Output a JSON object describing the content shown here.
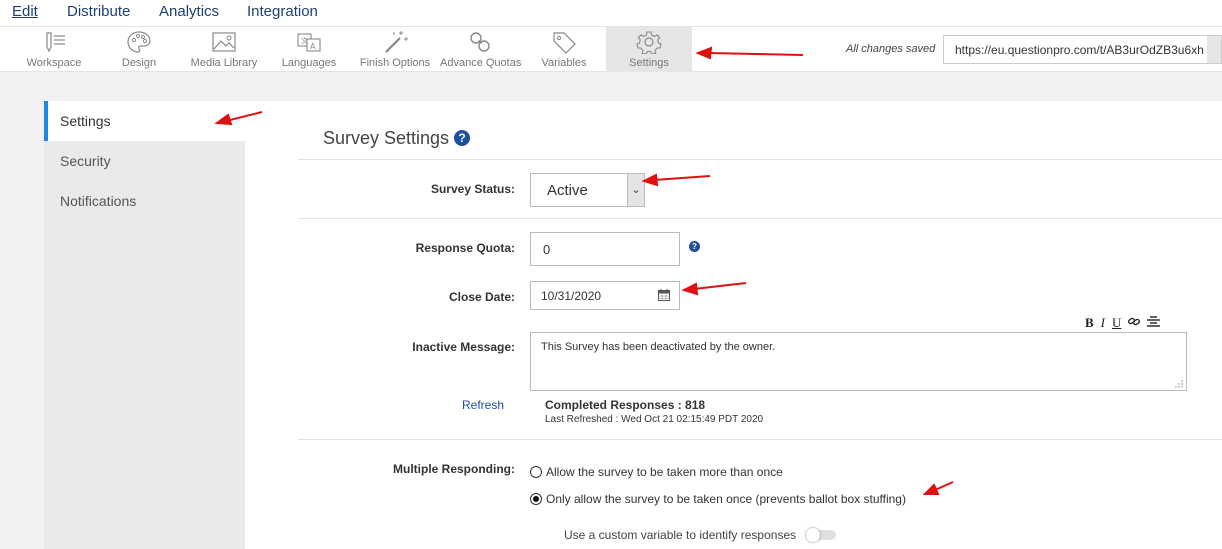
{
  "topnav": {
    "edit": "Edit",
    "distribute": "Distribute",
    "analytics": "Analytics",
    "integration": "Integration"
  },
  "toolbar": {
    "items": [
      {
        "label": "Workspace",
        "icon": "workspace-icon"
      },
      {
        "label": "Design",
        "icon": "palette-icon"
      },
      {
        "label": "Media Library",
        "icon": "image-icon"
      },
      {
        "label": "Languages",
        "icon": "translate-icon"
      },
      {
        "label": "Finish Options",
        "icon": "magic-wand-icon"
      },
      {
        "label": "Advance Quotas",
        "icon": "chain-icon"
      },
      {
        "label": "Variables",
        "icon": "tag-icon"
      },
      {
        "label": "Settings",
        "icon": "gear-icon"
      }
    ],
    "saved_text": "All changes saved",
    "url": "https://eu.questionpro.com/t/AB3urOdZB3u6xh"
  },
  "sidebar": {
    "items": [
      {
        "label": "Settings"
      },
      {
        "label": "Security"
      },
      {
        "label": "Notifications"
      }
    ]
  },
  "main": {
    "title": "Survey Settings",
    "survey_status_label": "Survey Status:",
    "survey_status_value": "Active",
    "response_quota_label": "Response Quota:",
    "response_quota_value": "0",
    "close_date_label": "Close Date:",
    "close_date_value": "10/31/2020",
    "inactive_message_label": "Inactive Message:",
    "inactive_message_value": "This Survey has been deactivated by the owner.",
    "rte": {
      "bold": "B",
      "italic": "I",
      "underline": "U"
    },
    "refresh_label": "Refresh",
    "completed_responses": "Completed Responses : 818",
    "last_refreshed": "Last Refreshed : Wed Oct 21 02:15:49 PDT 2020",
    "multiple_responding_label": "Multiple Responding:",
    "option_multiple": "Allow the survey to be taken more than once",
    "option_once": "Only allow the survey to be taken once (prevents ballot box stuffing)",
    "custom_variable_label": "Use a custom variable to identify responses"
  },
  "colors": {
    "accent": "#1e88e5",
    "nav_text": "#1d3f72",
    "annotation_arrow": "#e01010"
  }
}
